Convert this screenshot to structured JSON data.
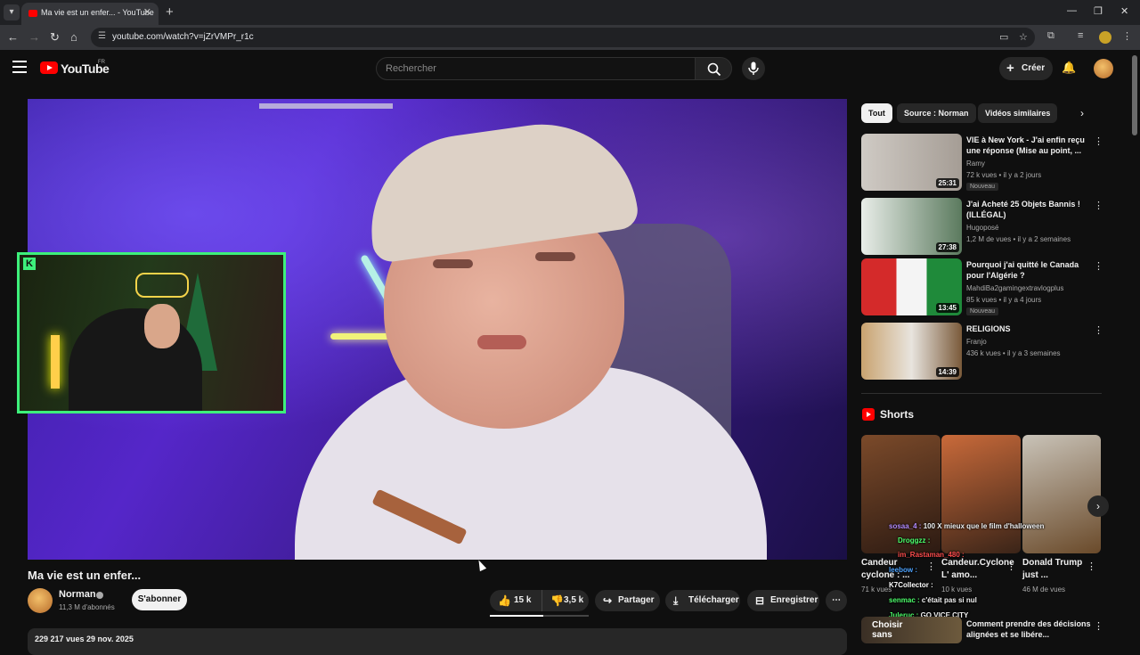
{
  "browser": {
    "tab_title": "Ma vie est un enfer... - YouTube",
    "url": "youtube.com/watch?v=jZrVMPr_r1c"
  },
  "header": {
    "logo_text": "YouTube",
    "country": "FR",
    "search_placeholder": "Rechercher",
    "create_label": "Créer"
  },
  "video": {
    "title": "Ma vie est un enfer...",
    "channel": "Norman",
    "subscribers": "11,3 M d'abonnés",
    "subscribe_label": "S'abonner",
    "likes": "15 k",
    "dislikes": "3,5 k",
    "share_label": "Partager",
    "download_label": "Télécharger",
    "save_label": "Enregistrer",
    "description_meta": "229 217 vues  29 nov. 2025"
  },
  "filters": [
    "Tout",
    "Source : Norman",
    "Vidéos similaires"
  ],
  "recommendations": [
    {
      "title": "VIE à New York - J'ai enfin reçu une réponse (Mise au point, ...",
      "channel": "Ramy",
      "meta": "72 k vues • il y a 2 jours",
      "duration": "25:31",
      "badge": "Nouveau"
    },
    {
      "title": "J'ai Acheté 25 Objets Bannis ! (ILLÉGAL)",
      "channel": "Hugoposé",
      "meta": "1,2 M de vues • il y a 2 semaines",
      "duration": "27:38",
      "badge": ""
    },
    {
      "title": "Pourquoi j'ai quitté le Canada pour l'Algérie ?",
      "channel": "MahdiBa2gamingextravlogplus",
      "meta": "85 k vues • il y a 4 jours",
      "duration": "13:45",
      "badge": "Nouveau"
    },
    {
      "title": "RELIGIONS",
      "channel": "Franjo",
      "meta": "436 k vues • il y a 3 semaines",
      "duration": "14:39",
      "badge": ""
    }
  ],
  "shorts": {
    "heading": "Shorts",
    "items": [
      {
        "title": "Candeur cyclone : ...",
        "views": "71 k vues"
      },
      {
        "title": "Candeur.Cyclone L' amo...",
        "views": "10 k vues"
      },
      {
        "title": "Donald Trump just ...",
        "views": "46 M de vues"
      }
    ]
  },
  "chat_overlay": [
    {
      "user": "sosaa_4 :",
      "msg": "100 X mieux que le film d'halloween",
      "color": "#b58cff"
    },
    {
      "user": "Droggzz :",
      "msg": "",
      "color": "#4dff6b"
    },
    {
      "user": "im_Rastaman_480 :",
      "msg": "",
      "color": "#ff4d4d"
    },
    {
      "user": "leebow :",
      "msg": "",
      "color": "#4da3ff"
    },
    {
      "user": "K7Collector :",
      "msg": "",
      "color": "#ffffff"
    },
    {
      "user": "senmac :",
      "msg": "c'était pas si nul",
      "color": "#4dff6b"
    },
    {
      "user": "Juleruc :",
      "msg": "GO VICE CITY",
      "color": "#4dff6b"
    }
  ],
  "last_rec": {
    "title": "Comment prendre des décisions alignées et se libére...",
    "thumb_text": "Choisir sans"
  }
}
